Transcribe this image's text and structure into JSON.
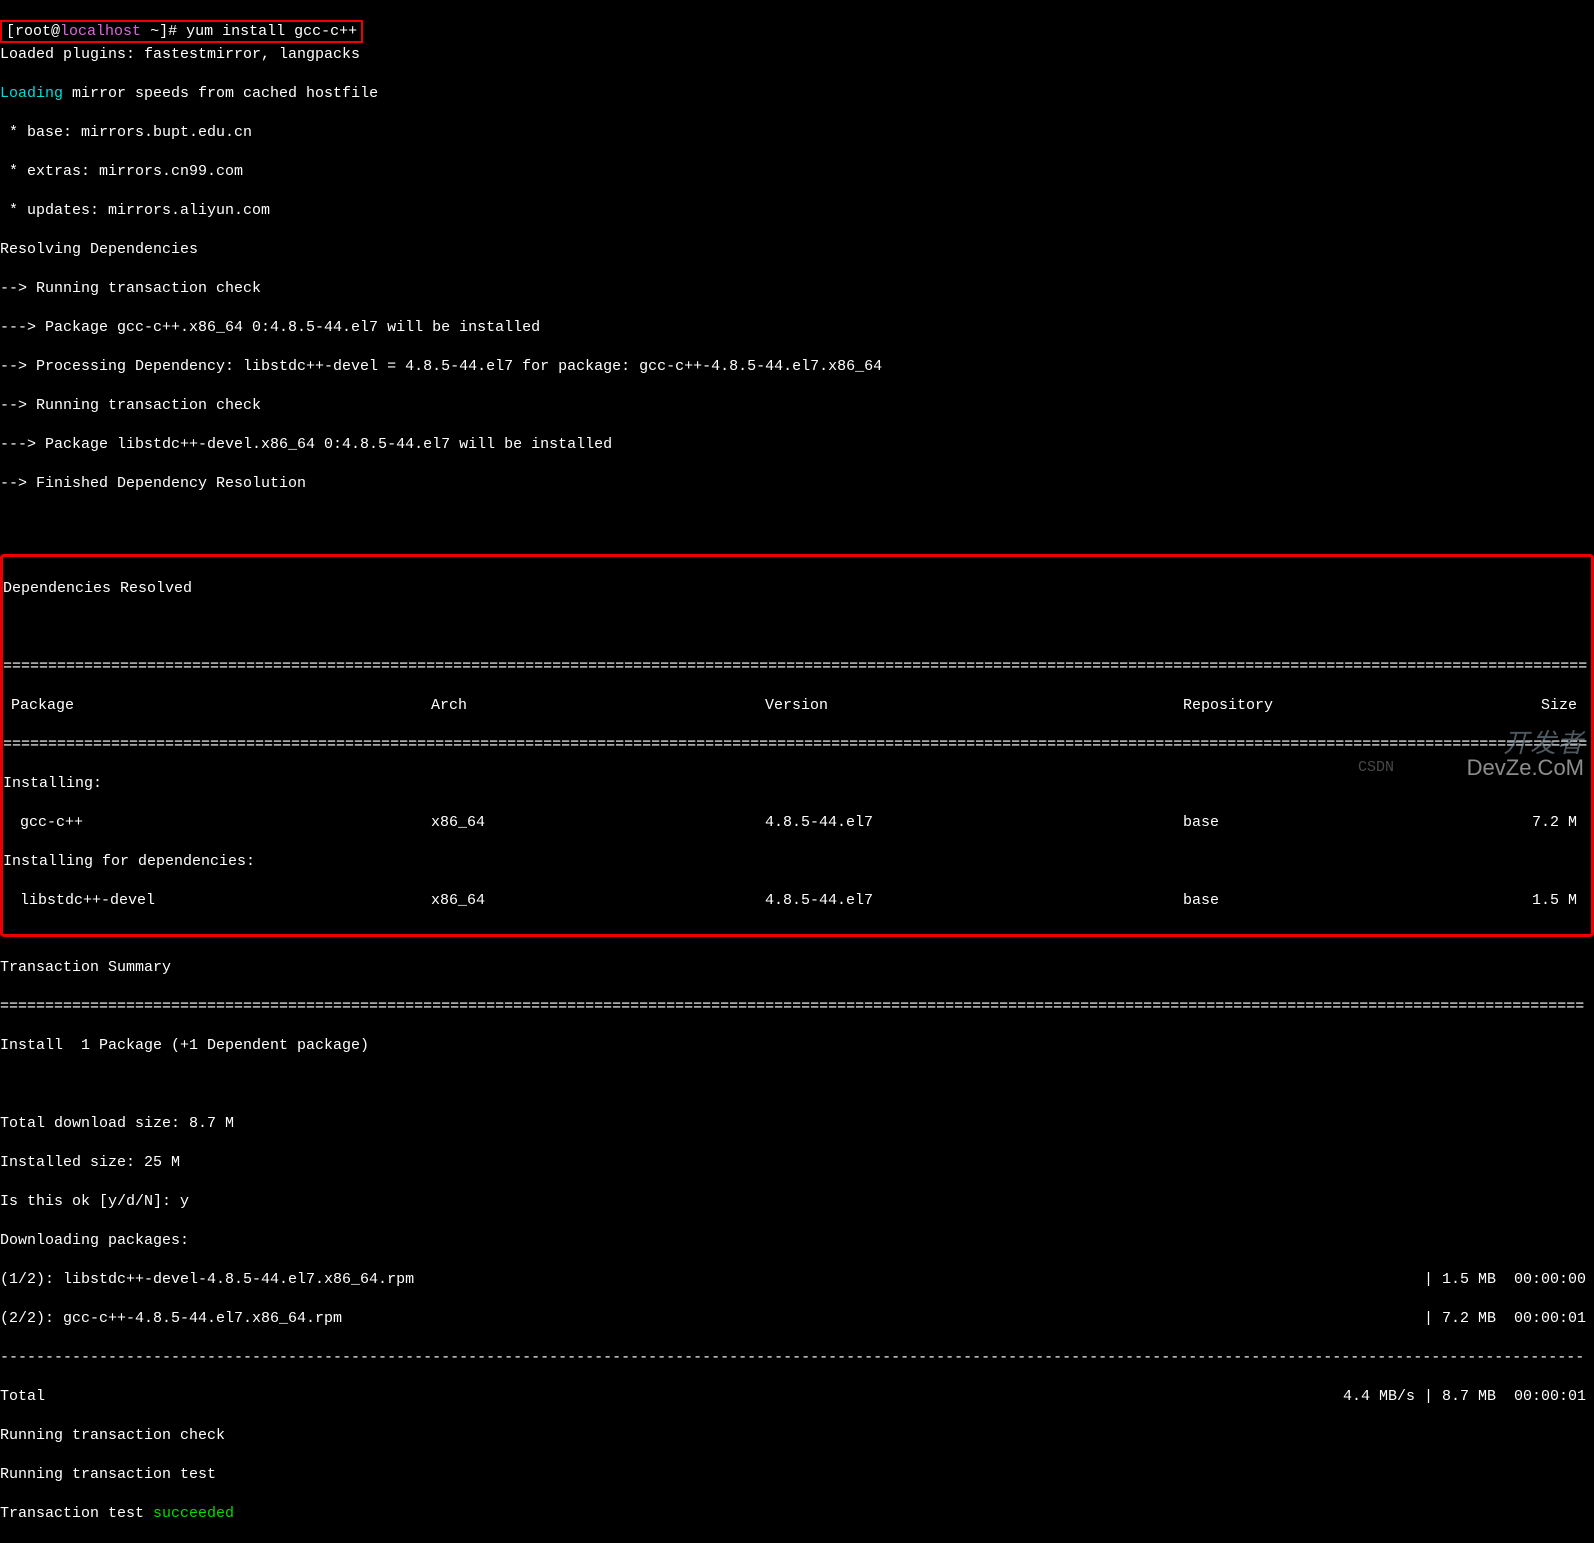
{
  "prompt": {
    "user": "root",
    "at": "@",
    "host": "localhost",
    "path": " ~",
    "hash": "]# ",
    "command": "yum install gcc-c++",
    "bracket_open": "[",
    "bracket_close": ""
  },
  "lines": {
    "l1": "Loaded plugins: fastestmirror, langpacks",
    "l2a": "Loading",
    "l2b": " mirror speeds from cached hostfile",
    "l3": " * base: mirrors.bupt.edu.cn",
    "l4": " * extras: mirrors.cn99.com",
    "l5": " * updates: mirrors.aliyun.com",
    "l6": "Resolving Dependencies",
    "l7": "--> Running transaction check",
    "l8": "---> Package gcc-c++.x86_64 0:4.8.5-44.el7 will be installed",
    "l9": "--> Processing Dependency: libstdc++-devel = 4.8.5-44.el7 for package: gcc-c++-4.8.5-44.el7.x86_64",
    "l10": "--> Running transaction check",
    "l11": "---> Package libstdc++-devel.x86_64 0:4.8.5-44.el7 will be installed",
    "l12": "--> Finished Dependency Resolution"
  },
  "deps": {
    "title": "Dependencies Resolved",
    "sep": "================================================================================================================================================================================",
    "headers": {
      "c1": "Package",
      "c2": "Arch",
      "c3": "Version",
      "c4": "Repository",
      "c5": "Size"
    },
    "installing": "Installing:",
    "row1": {
      "c1": " gcc-c++",
      "c2": "x86_64",
      "c3": "4.8.5-44.el7",
      "c4": "base",
      "c5": "7.2 M"
    },
    "installing_deps": "Installing for dependencies:",
    "row2": {
      "c1": " libstdc++-devel",
      "c2": "x86_64",
      "c3": "4.8.5-44.el7",
      "c4": "base",
      "c5": "1.5 M"
    }
  },
  "summary": {
    "title": "Transaction Summary",
    "sep": "================================================================================================================================================================================",
    "install": "Install  1 Package (+1 Dependent package)",
    "total_dl": "Total download size: 8.7 M",
    "installed": "Installed size: 25 M",
    "confirm": "Is this ok [y/d/N]: y",
    "downloading": "Downloading packages:",
    "dl1_left": "(1/2): libstdc++-devel-4.8.5-44.el7.x86_64.rpm",
    "dl1_right": "| 1.5 MB  00:00:00",
    "dl2_left": "(2/2): gcc-c++-4.8.5-44.el7.x86_64.rpm",
    "dl2_right": "| 7.2 MB  00:00:01",
    "dash": "--------------------------------------------------------------------------------------------------------------------------------------------------------------------------------",
    "total_left": "Total",
    "total_right": "4.4 MB/s | 8.7 MB  00:00:01",
    "run_check": "Running transaction check",
    "run_test": "Running transaction test",
    "tt_label": "Transaction test ",
    "tt_status": "succeeded"
  },
  "watermarks": {
    "w1": "开发者",
    "w2": "DevZe.CoM",
    "csdn": "CSDN"
  }
}
